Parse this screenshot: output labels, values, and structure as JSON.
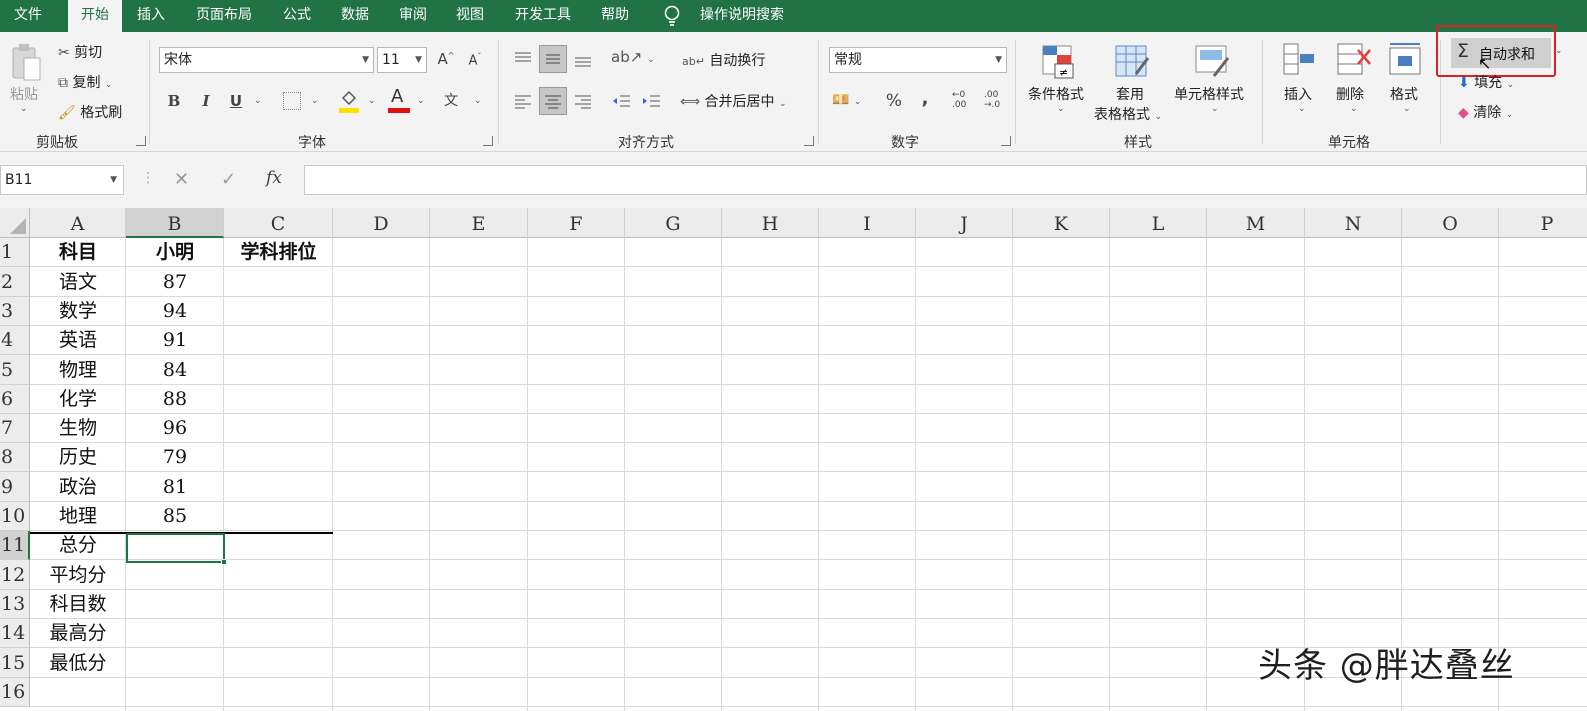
{
  "tabs": [
    "文件",
    "开始",
    "插入",
    "页面布局",
    "公式",
    "数据",
    "审阅",
    "视图",
    "开发工具",
    "帮助"
  ],
  "search_label": "操作说明搜索",
  "ribbon": {
    "clipboard": {
      "paste": "粘贴",
      "cut": "剪切",
      "copy": "复制",
      "format_painter": "格式刷",
      "group": "剪贴板"
    },
    "font": {
      "name": "宋体",
      "size": "11",
      "group": "字体",
      "bold": "B",
      "italic": "I",
      "underline": "U",
      "font_color": "A"
    },
    "align": {
      "wrap": "自动换行",
      "merge": "合并后居中",
      "group": "对齐方式"
    },
    "number": {
      "format": "常规",
      "percent": "%",
      "comma": ",",
      "group": "数字"
    },
    "styles": {
      "conditional": "条件格式",
      "table_line1": "套用",
      "table_line2": "表格格式",
      "cell_styles": "单元格样式",
      "group": "样式"
    },
    "cells": {
      "insert": "插入",
      "delete": "删除",
      "format": "格式",
      "group": "单元格"
    },
    "editing": {
      "autosum": "自动求和",
      "fill": "填充",
      "clear": "清除",
      "sigma": "Σ"
    }
  },
  "formula_bar": {
    "name_box": "B11",
    "cancel": "✕",
    "enter": "✓",
    "fx": "fx",
    "content": ""
  },
  "columns": [
    "A",
    "B",
    "C",
    "D",
    "E",
    "F",
    "G",
    "H",
    "I",
    "J",
    "K",
    "L",
    "M",
    "N",
    "O",
    "P"
  ],
  "rows": [
    "1",
    "2",
    "3",
    "4",
    "5",
    "6",
    "7",
    "8",
    "9",
    "10",
    "11",
    "12",
    "13",
    "14",
    "15",
    "16"
  ],
  "cells": {
    "a": [
      "科目",
      "语文",
      "数学",
      "英语",
      "物理",
      "化学",
      "生物",
      "历史",
      "政治",
      "地理",
      "总分",
      "平均分",
      "科目数",
      "最高分",
      "最低分",
      ""
    ],
    "b": [
      "小明",
      "87",
      "94",
      "91",
      "84",
      "88",
      "96",
      "79",
      "81",
      "85",
      "",
      "",
      "",
      "",
      "",
      ""
    ],
    "c": [
      "学科排位",
      "",
      "",
      "",
      "",
      "",
      "",
      "",
      "",
      "",
      "",
      "",
      "",
      "",
      "",
      ""
    ]
  },
  "selected_cell": "B11",
  "highlight_color": "#e02020",
  "accent_color": "#217346",
  "watermark": "头条 @胖达叠丝"
}
